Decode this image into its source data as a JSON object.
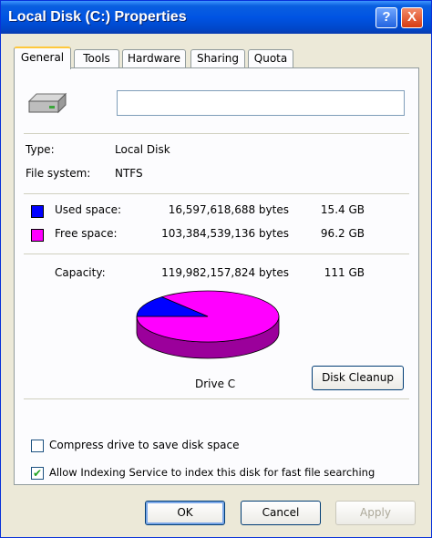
{
  "window": {
    "title": "Local Disk (C:) Properties"
  },
  "titlebar_buttons": {
    "help": "?",
    "close": "X"
  },
  "tabs": [
    {
      "label": "General",
      "active": true
    },
    {
      "label": "Tools",
      "active": false
    },
    {
      "label": "Hardware",
      "active": false
    },
    {
      "label": "Sharing",
      "active": false
    },
    {
      "label": "Quota",
      "active": false
    }
  ],
  "general": {
    "drive_name_value": "",
    "type_label": "Type:",
    "type_value": "Local Disk",
    "fs_label": "File system:",
    "fs_value": "NTFS",
    "used_label": "Used space:",
    "used_bytes": "16,597,618,688 bytes",
    "used_gb": "15.4 GB",
    "free_label": "Free space:",
    "free_bytes": "103,384,539,136 bytes",
    "free_gb": "96.2 GB",
    "capacity_label": "Capacity:",
    "capacity_bytes": "119,982,157,824 bytes",
    "capacity_gb": "111 GB",
    "drive_label": "Drive C",
    "cleanup_label": "Disk Cleanup",
    "used_fraction": 0.138,
    "compress_label": "Compress drive to save disk space",
    "compress_checked": false,
    "index_label": "Allow Indexing Service to index this disk for fast file searching",
    "index_checked": true
  },
  "colors": {
    "used": "#0000ff",
    "free": "#ff00ff"
  },
  "buttons": {
    "ok": "OK",
    "cancel": "Cancel",
    "apply": "Apply"
  },
  "icons": {
    "drive": "hard-drive-icon",
    "check": "checkmark-icon"
  }
}
